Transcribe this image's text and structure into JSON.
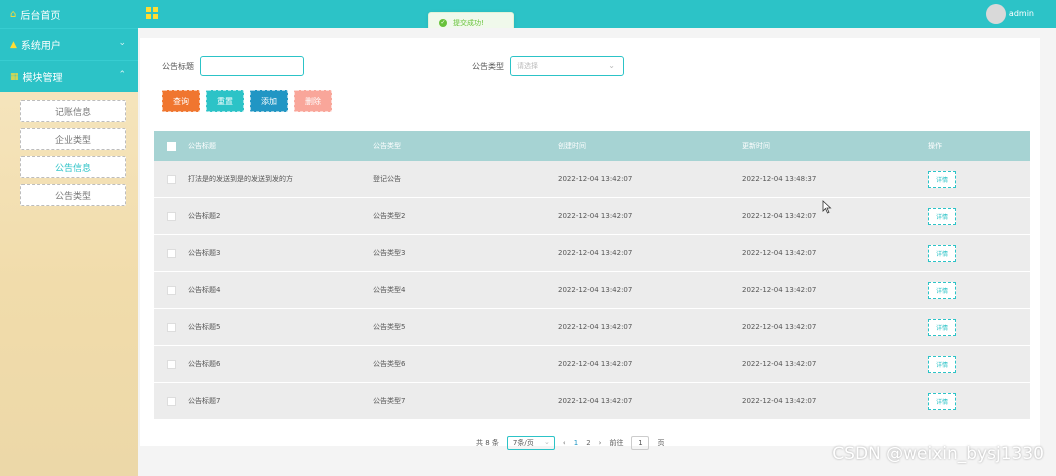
{
  "sidebar": {
    "home": "后台首页",
    "menus": [
      {
        "label": "系统用户"
      },
      {
        "label": "模块管理"
      }
    ],
    "items": [
      {
        "label": "记账信息"
      },
      {
        "label": "企业类型"
      },
      {
        "label": "公告信息"
      },
      {
        "label": "公告类型"
      }
    ]
  },
  "header": {
    "user": "admin",
    "toast": "提交成功!"
  },
  "search": {
    "title_label": "公告标题",
    "type_label": "公告类型",
    "type_placeholder": "请选择"
  },
  "buttons": {
    "query": "查询",
    "reset": "重置",
    "add": "添加",
    "delete": "删除"
  },
  "table": {
    "headers": [
      "公告标题",
      "公告类型",
      "创建时间",
      "更新时间",
      "操作"
    ],
    "rows": [
      {
        "title": "打法是的发送到是的发送到发的方",
        "type": "登记公告",
        "created": "2022-12-04 13:42:07",
        "updated": "2022-12-04 13:48:37",
        "action": "详情"
      },
      {
        "title": "公告标题2",
        "type": "公告类型2",
        "created": "2022-12-04 13:42:07",
        "updated": "2022-12-04 13:42:07",
        "action": "详情"
      },
      {
        "title": "公告标题3",
        "type": "公告类型3",
        "created": "2022-12-04 13:42:07",
        "updated": "2022-12-04 13:42:07",
        "action": "详情"
      },
      {
        "title": "公告标题4",
        "type": "公告类型4",
        "created": "2022-12-04 13:42:07",
        "updated": "2022-12-04 13:42:07",
        "action": "详情"
      },
      {
        "title": "公告标题5",
        "type": "公告类型5",
        "created": "2022-12-04 13:42:07",
        "updated": "2022-12-04 13:42:07",
        "action": "详情"
      },
      {
        "title": "公告标题6",
        "type": "公告类型6",
        "created": "2022-12-04 13:42:07",
        "updated": "2022-12-04 13:42:07",
        "action": "详情"
      },
      {
        "title": "公告标题7",
        "type": "公告类型7",
        "created": "2022-12-04 13:42:07",
        "updated": "2022-12-04 13:42:07",
        "action": "详情"
      }
    ]
  },
  "pagination": {
    "total": "共 8 条",
    "page_size": "7条/页",
    "pages": [
      "1",
      "2"
    ],
    "goto_label": "前往",
    "goto_value": "1",
    "page_suffix": "页"
  },
  "watermark": "CSDN @weixin_bysj1330",
  "colors": {
    "accent": "#2cc3c7",
    "query": "#f0762f",
    "add": "#2196c4",
    "delete": "#f9a69a"
  }
}
